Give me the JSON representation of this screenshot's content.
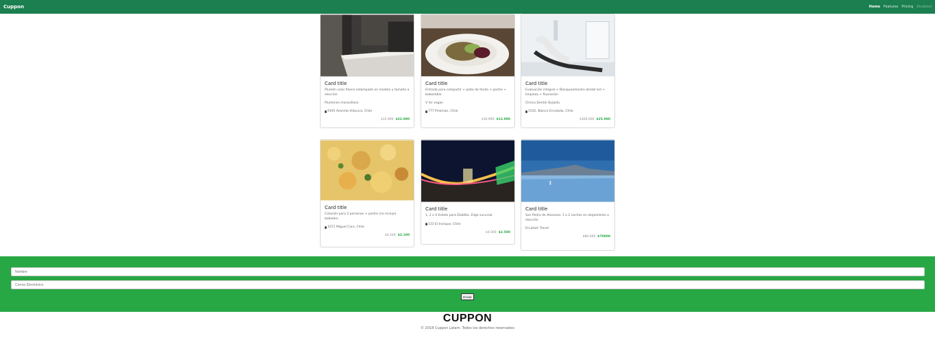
{
  "navbar": {
    "brand": "Cuppon",
    "links": [
      {
        "label": "Home",
        "state": "active"
      },
      {
        "label": "Features",
        "state": "normal"
      },
      {
        "label": "Pricing",
        "state": "normal"
      },
      {
        "label": "Disabled",
        "state": "disabled"
      }
    ]
  },
  "cards": [
    {
      "title": "Card title",
      "text": "Plumón color fleece estampado en modelo y tamaño a elección",
      "vendor": "Plumones maravilloso",
      "address": "9191 Avenida Vitacura, Chile",
      "old_price": "$15.990",
      "new_price": "$22.990"
    },
    {
      "title": "Card title",
      "text": "Entrada para compartir + plato de fondo + postre + bebestible",
      "vendor": "V for vegan",
      "address": "777 Pinkman, Chile",
      "old_price": "$30.990",
      "new_price": "$12.990"
    },
    {
      "title": "Card title",
      "text": "Evaluación integral + Blanqueamiento dental led + limpieza + fluoración",
      "vendor": "Clínica Dental Quijada",
      "address": "1542, Blanco Encalada, Chile.",
      "old_price": "$300.000",
      "new_price": "$25.990"
    },
    {
      "title": "Card title",
      "text": "Colación para 2 personas + postre (no incluye bebidas).",
      "vendor": "",
      "address": "1071 Miguel Caro, Chile",
      "old_price": "$4.200",
      "new_price": "$2.100"
    },
    {
      "title": "Card title",
      "text": "1, 2 o 4 tickets para Diablito. Elige sucursal",
      "vendor": "",
      "address": "133 El tranque, Chile",
      "old_price": "$4.000",
      "new_price": "$2.500"
    },
    {
      "title": "Card title",
      "text": "San Pedro de Atacama: 1 o 2 noches en alojamiento a elección",
      "vendor": "D-Latam Travel",
      "address": "",
      "old_price": "$80.000",
      "new_price": "$70000"
    }
  ],
  "form": {
    "name_placeholder": "Nombre",
    "email_placeholder": "Correo Electrónico",
    "submit_label": "Enviar"
  },
  "footer": {
    "logo": "CUPPON",
    "copyright": "© 2018 Cuppon Latam. Todos los derechos reservados"
  }
}
